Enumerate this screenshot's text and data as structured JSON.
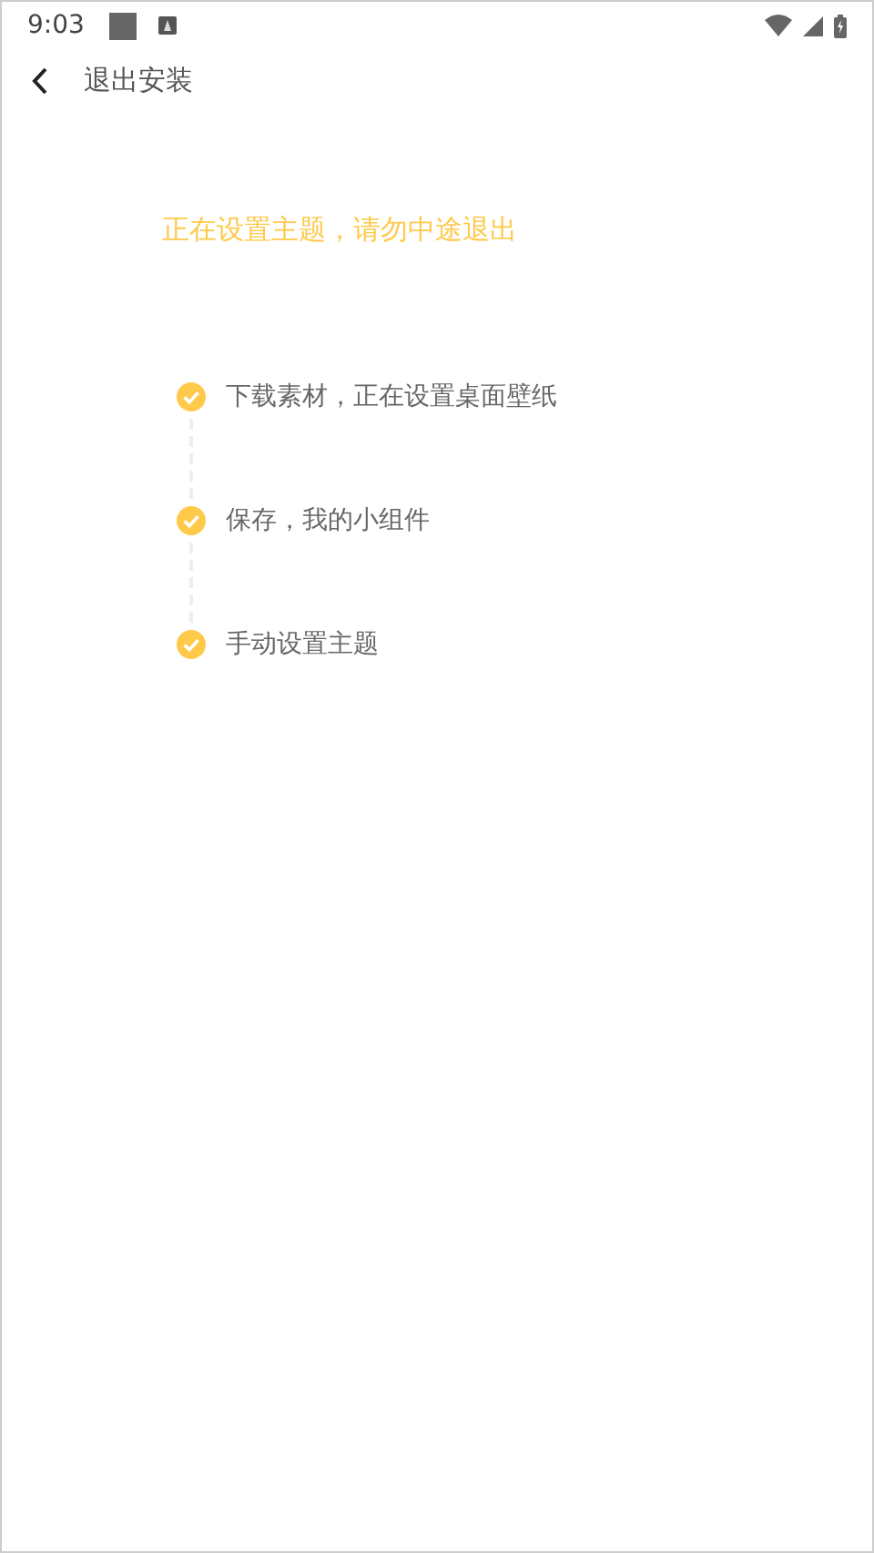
{
  "status_bar": {
    "time": "9:03"
  },
  "header": {
    "title": "退出安装"
  },
  "notice": "正在设置主题，请勿中途退出",
  "steps": [
    {
      "label": "下载素材，正在设置桌面壁纸",
      "done": true
    },
    {
      "label": "保存，我的小组件",
      "done": true
    },
    {
      "label": "手动设置主题",
      "done": true
    }
  ]
}
